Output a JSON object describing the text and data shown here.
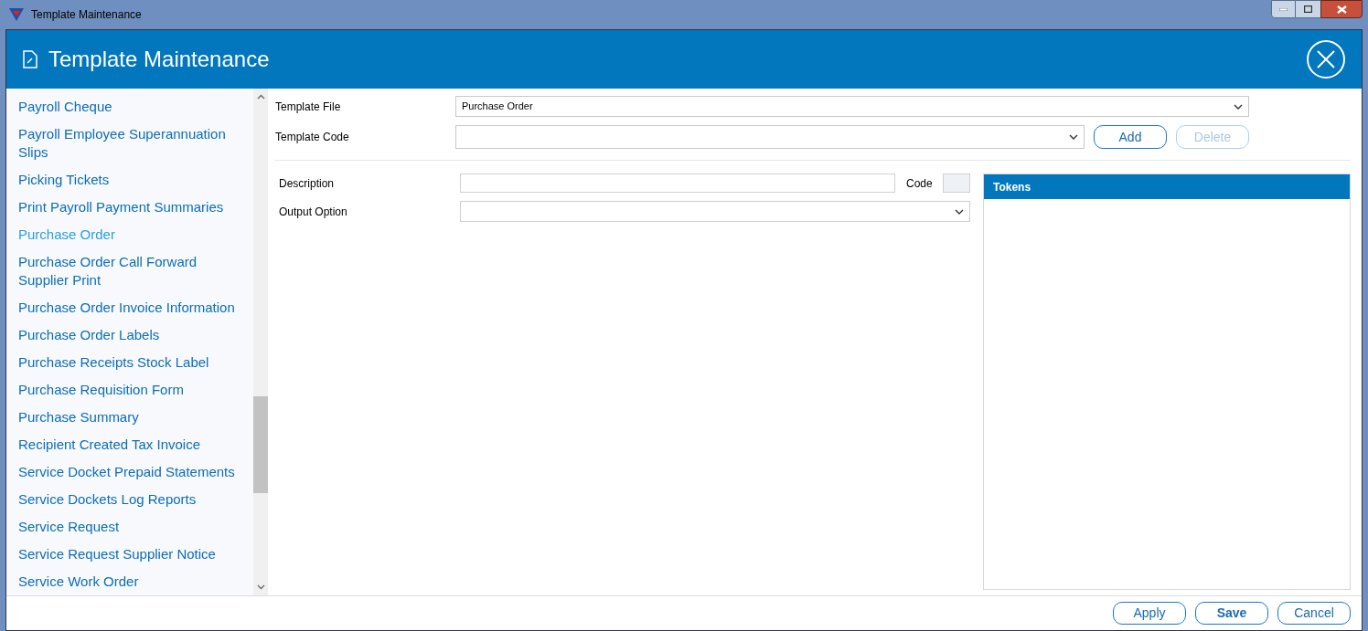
{
  "window": {
    "title": "Template Maintenance"
  },
  "header": {
    "title": "Template Maintenance"
  },
  "sidebar": {
    "items": [
      {
        "label": "Payroll Cheque",
        "selected": false
      },
      {
        "label": "Payroll Employee Superannuation Slips",
        "selected": false
      },
      {
        "label": "Picking Tickets",
        "selected": false
      },
      {
        "label": "Print Payroll Payment Summaries",
        "selected": false
      },
      {
        "label": "Purchase Order",
        "selected": true
      },
      {
        "label": "Purchase Order Call Forward Supplier Print",
        "selected": false
      },
      {
        "label": "Purchase Order Invoice Information",
        "selected": false
      },
      {
        "label": "Purchase Order Labels",
        "selected": false
      },
      {
        "label": "Purchase Receipts Stock Label",
        "selected": false
      },
      {
        "label": "Purchase Requisition Form",
        "selected": false
      },
      {
        "label": "Purchase Summary",
        "selected": false
      },
      {
        "label": "Recipient Created Tax Invoice",
        "selected": false
      },
      {
        "label": "Service Docket Prepaid Statements",
        "selected": false
      },
      {
        "label": "Service Dockets Log Reports",
        "selected": false
      },
      {
        "label": "Service Request",
        "selected": false
      },
      {
        "label": "Service Request Supplier Notice",
        "selected": false
      },
      {
        "label": "Service Work Order",
        "selected": false
      }
    ]
  },
  "form": {
    "template_file": {
      "label": "Template File",
      "value": "Purchase Order"
    },
    "template_code": {
      "label": "Template Code"
    },
    "buttons": [
      {
        "label": "Add",
        "disabled": false
      },
      {
        "label": "Delete",
        "disabled": true
      }
    ],
    "description": {
      "label": "Description"
    },
    "code": {
      "label": "Code"
    },
    "output_option": {
      "label": "Output Option"
    }
  },
  "tokens": {
    "title": "Tokens"
  },
  "footer": {
    "buttons": [
      {
        "label": "Apply",
        "bold": false
      },
      {
        "label": "Save",
        "bold": true
      },
      {
        "label": "Cancel",
        "bold": false
      }
    ]
  }
}
